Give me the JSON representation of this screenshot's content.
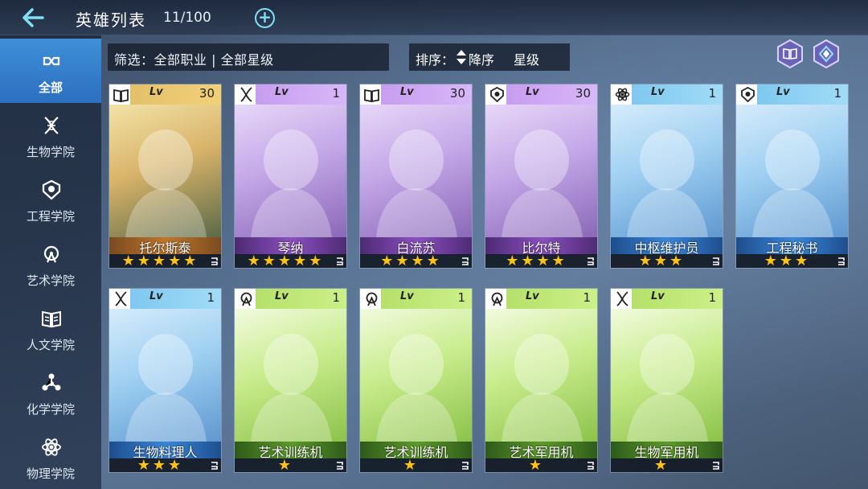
{
  "header": {
    "title": "英雄列表",
    "count": "11/100"
  },
  "sidebar": {
    "items": [
      {
        "label": "全部",
        "icon": "infinity-icon",
        "active": true
      },
      {
        "label": "生物学院",
        "icon": "dna-icon"
      },
      {
        "label": "工程学院",
        "icon": "gear-shield-icon"
      },
      {
        "label": "艺术学院",
        "icon": "art-compass-icon"
      },
      {
        "label": "人文学院",
        "icon": "open-book-icon"
      },
      {
        "label": "化学学院",
        "icon": "molecule-icon"
      },
      {
        "label": "物理学院",
        "icon": "atom-icon"
      }
    ]
  },
  "filter": {
    "text": "筛选：全部职业 | 全部星级"
  },
  "sort": {
    "label": "排序：",
    "order": "降序",
    "field": "星级"
  },
  "heroes": [
    {
      "name": "托尔斯泰",
      "level": "30",
      "stars": "★★★★★",
      "class_icon": "open-book-icon",
      "rarity_color": "#c0762a"
    },
    {
      "name": "琴纳",
      "level": "1",
      "stars": "★★★★★",
      "class_icon": "dna-icon",
      "rarity_color": "#8a4fc0"
    },
    {
      "name": "白流苏",
      "level": "30",
      "stars": "★★★★",
      "class_icon": "open-book-icon",
      "rarity_color": "#8a4fc0"
    },
    {
      "name": "比尔特",
      "level": "30",
      "stars": "★★★★",
      "class_icon": "gear-shield-icon",
      "rarity_color": "#8a4fc0"
    },
    {
      "name": "中枢维护员",
      "level": "1",
      "stars": "★★★",
      "class_icon": "atom-icon",
      "rarity_color": "#3a86d8"
    },
    {
      "name": "工程秘书",
      "level": "1",
      "stars": "★★★",
      "class_icon": "gear-shield-icon",
      "rarity_color": "#3a86d8"
    },
    {
      "name": "生物料理人",
      "level": "1",
      "stars": "★★★",
      "class_icon": "dna-icon",
      "rarity_color": "#3a86d8"
    },
    {
      "name": "艺术训练机",
      "level": "1",
      "stars": "★",
      "class_icon": "art-compass-icon",
      "rarity_color": "#5e9a2a"
    },
    {
      "name": "艺术训练机",
      "level": "1",
      "stars": "★",
      "class_icon": "art-compass-icon",
      "rarity_color": "#5e9a2a"
    },
    {
      "name": "艺术军用机",
      "level": "1",
      "stars": "★",
      "class_icon": "art-compass-icon",
      "rarity_color": "#5e9a2a"
    },
    {
      "name": "生物军用机",
      "level": "1",
      "stars": "★",
      "class_icon": "dna-icon",
      "rarity_color": "#5e9a2a"
    }
  ],
  "lv_label": "Lv"
}
